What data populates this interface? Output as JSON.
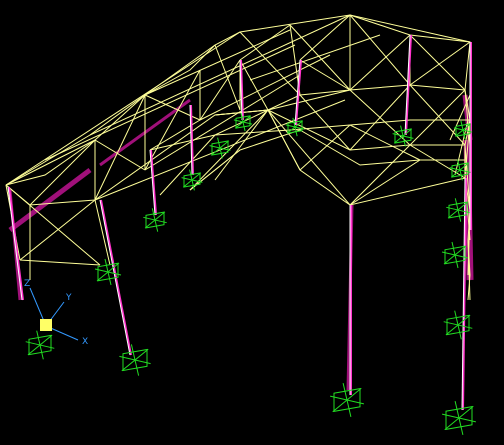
{
  "viewport": {
    "background": "#000000",
    "truss_color": "#ffff99",
    "column_color": "#ffff99",
    "member_highlight_color": "#a0107a",
    "support_color": "#22dd22"
  },
  "axis_triad": {
    "x_label": "X",
    "y_label": "Y",
    "z_label": "Z",
    "x_color": "#3399ff",
    "y_color": "#3399ff",
    "z_color": "#3399ff",
    "origin_color": "#ffff66"
  }
}
